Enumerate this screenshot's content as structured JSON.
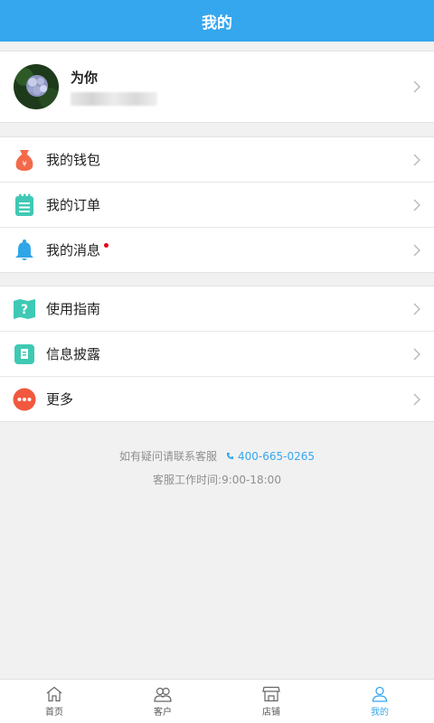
{
  "header": {
    "title": "我的"
  },
  "profile": {
    "name": "为你"
  },
  "menu_group_1": [
    {
      "label": "我的钱包",
      "icon": "wallet-bag-icon"
    },
    {
      "label": "我的订单",
      "icon": "order-notepad-icon"
    },
    {
      "label": "我的消息",
      "icon": "bell-icon",
      "unread_dot": true
    }
  ],
  "menu_group_2": [
    {
      "label": "使用指南",
      "icon": "guide-map-icon"
    },
    {
      "label": "信息披露",
      "icon": "disclosure-book-icon"
    },
    {
      "label": "更多",
      "icon": "more-dots-icon"
    }
  ],
  "contact": {
    "prompt": "如有疑问请联系客服",
    "phone": "400-665-0265",
    "hours": "客服工作时间:9:00-18:00"
  },
  "tabbar": [
    {
      "label": "首页",
      "icon": "home-icon"
    },
    {
      "label": "客户",
      "icon": "customers-icon"
    },
    {
      "label": "店铺",
      "icon": "store-icon"
    },
    {
      "label": "我的",
      "icon": "profile-icon",
      "active": true
    }
  ],
  "colors": {
    "accent": "#35a7ee",
    "unread_dot": "#e60012"
  }
}
